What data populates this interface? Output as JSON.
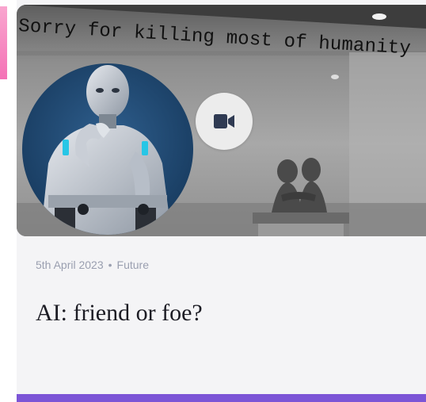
{
  "image_overlay_text": "Sorry for killing most of humanity",
  "video_icon": "video-camera-icon",
  "post": {
    "date": "5th April 2023",
    "separator": "•",
    "category": "Future",
    "title": "AI: friend or foe?"
  },
  "colors": {
    "accent": "#7c55d6",
    "card_background": "#f4f4f6",
    "meta_text": "#9a9fb0",
    "title_text": "#1c1c24",
    "avatar_circle": "#1f4a73",
    "pink_edge": "#f472b6"
  }
}
